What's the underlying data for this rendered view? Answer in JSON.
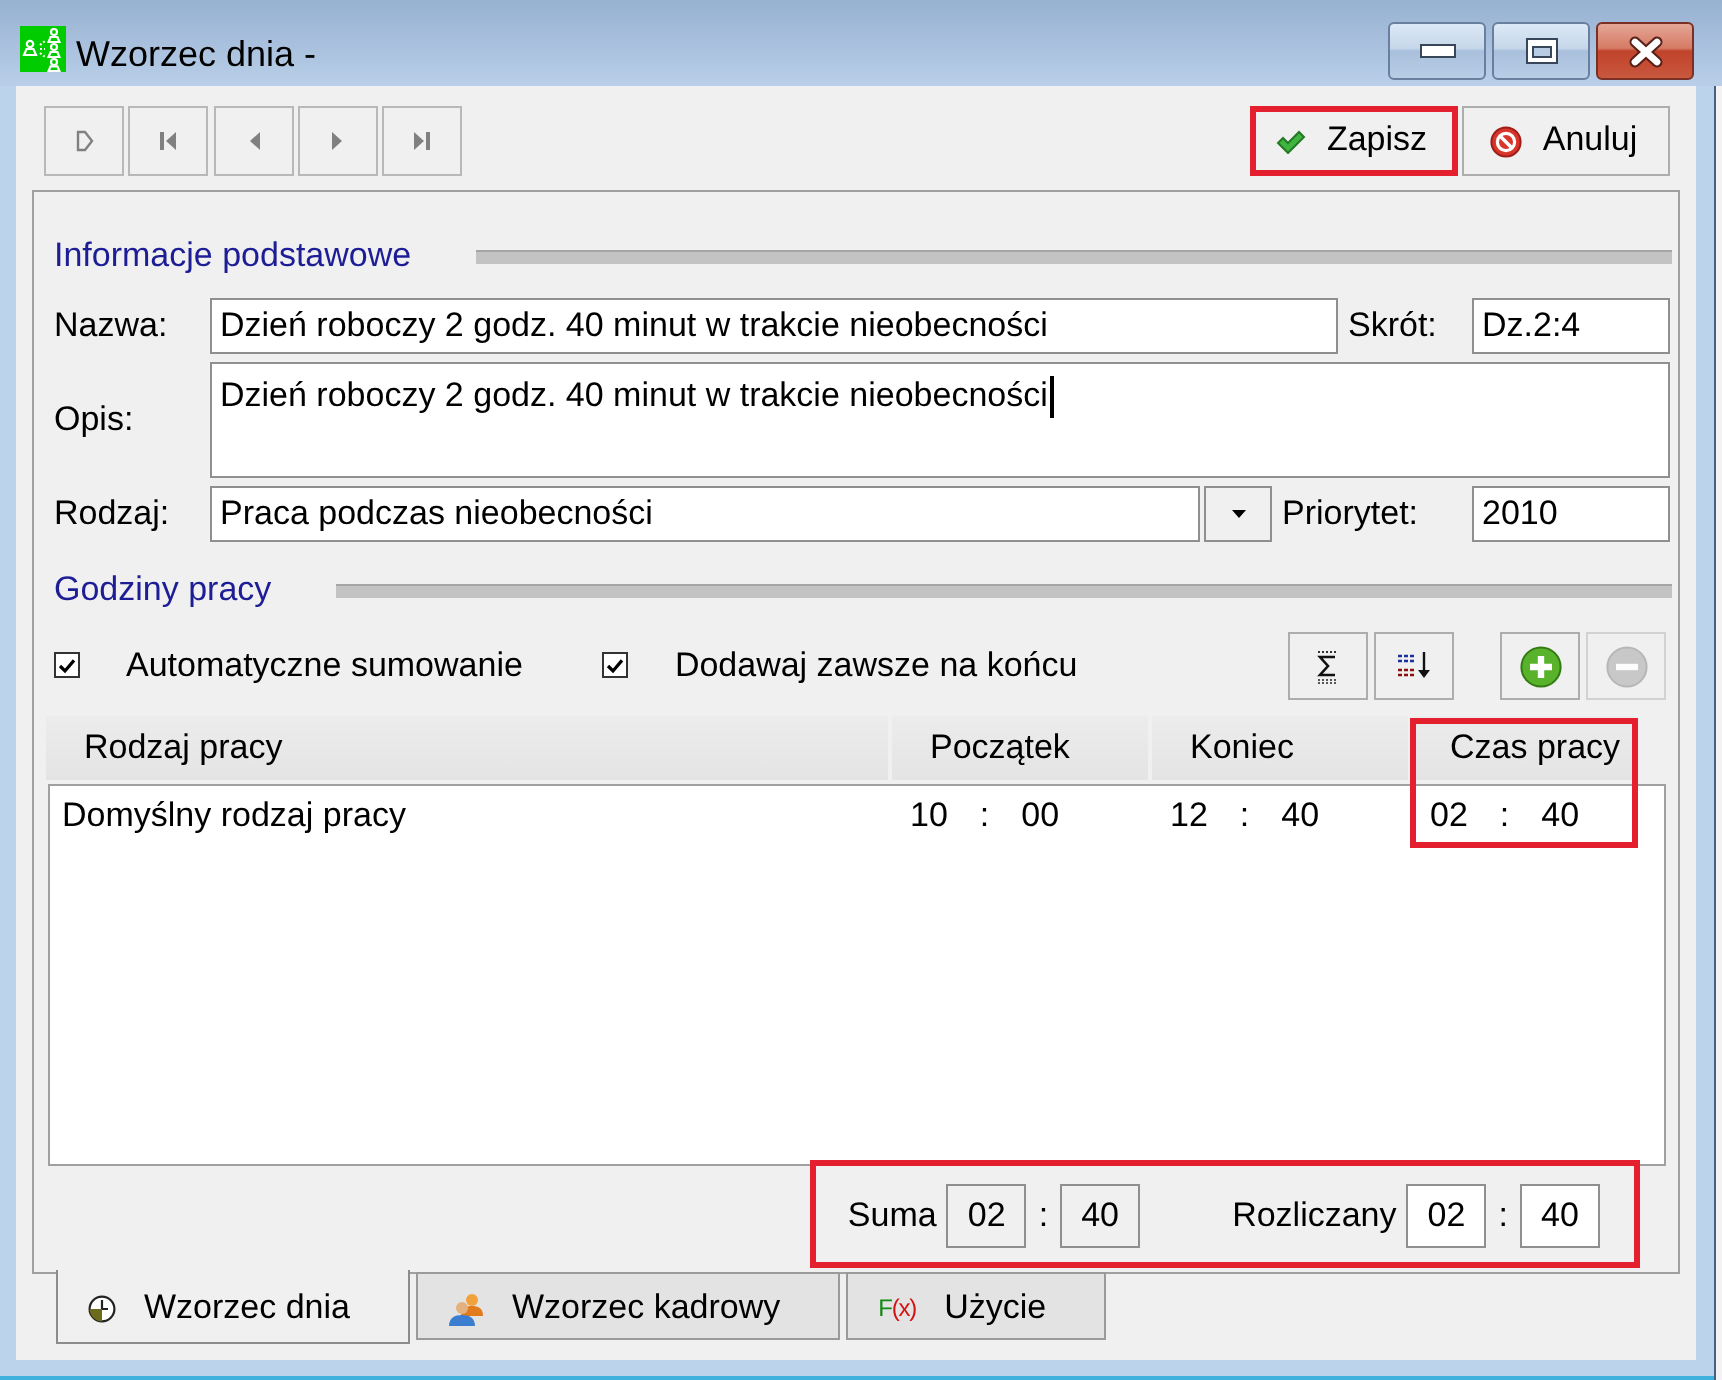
{
  "window": {
    "title": "Wzorzec dnia -"
  },
  "actions": [
    {
      "kind": "save",
      "label": "Zapisz",
      "highlighted": true
    },
    {
      "kind": "cancel",
      "label": "Anuluj",
      "highlighted": false
    }
  ],
  "basic_info": {
    "heading": "Informacje podstawowe",
    "name": {
      "label": "Nazwa:",
      "value": "Dzień roboczy 2 godz. 40 minut w trakcie nieobecności"
    },
    "short_name": {
      "label": "Skrót:",
      "value": "Dz.2:4"
    },
    "description": {
      "label": "Opis:",
      "value": "Dzień roboczy 2 godz. 40 minut w trakcie nieobecności",
      "focused": true
    },
    "type": {
      "label": "Rodzaj:",
      "value": "Praca podczas nieobecności"
    },
    "priority": {
      "label": "Priorytet:",
      "value": "2010"
    }
  },
  "working_hours": {
    "heading": "Godziny pracy",
    "options": [
      {
        "label": "Automatyczne sumowanie",
        "checked": true
      },
      {
        "label": "Dodawaj zawsze na końcu",
        "checked": true
      }
    ],
    "tools": [
      {
        "kind": "sum",
        "disabled": false
      },
      {
        "kind": "sort",
        "disabled": false
      },
      {
        "kind": "add",
        "disabled": false
      },
      {
        "kind": "remove",
        "disabled": true
      }
    ],
    "table": {
      "columns": [
        {
          "label": "Rodzaj pracy",
          "highlighted": false
        },
        {
          "label": "Początek",
          "highlighted": false
        },
        {
          "label": "Koniec",
          "highlighted": false
        },
        {
          "label": "Czas pracy",
          "highlighted": true
        }
      ],
      "rows": [
        {
          "work_type": "Domyślny rodzaj pracy",
          "start": {
            "hours": "10",
            "separator": ":",
            "minutes": "00"
          },
          "end": {
            "hours": "12",
            "separator": ":",
            "minutes": "40"
          },
          "duration": {
            "hours": "02",
            "separator": ":",
            "minutes": "40"
          }
        }
      ]
    },
    "totals": {
      "highlighted": true,
      "items": [
        {
          "label": "Suma",
          "hours": "02",
          "separator": ":",
          "minutes": "40",
          "read_only": true
        },
        {
          "label": "Rozliczany",
          "hours": "02",
          "separator": ":",
          "minutes": "40",
          "read_only": false
        }
      ]
    }
  },
  "tabs": [
    {
      "kind": "day",
      "label": "Wzorzec dnia",
      "selected": true
    },
    {
      "kind": "staff",
      "label": "Wzorzec kadrowy",
      "selected": false
    },
    {
      "kind": "usage",
      "label": "Użycie",
      "glyph": "F(x)",
      "selected": false
    }
  ]
}
